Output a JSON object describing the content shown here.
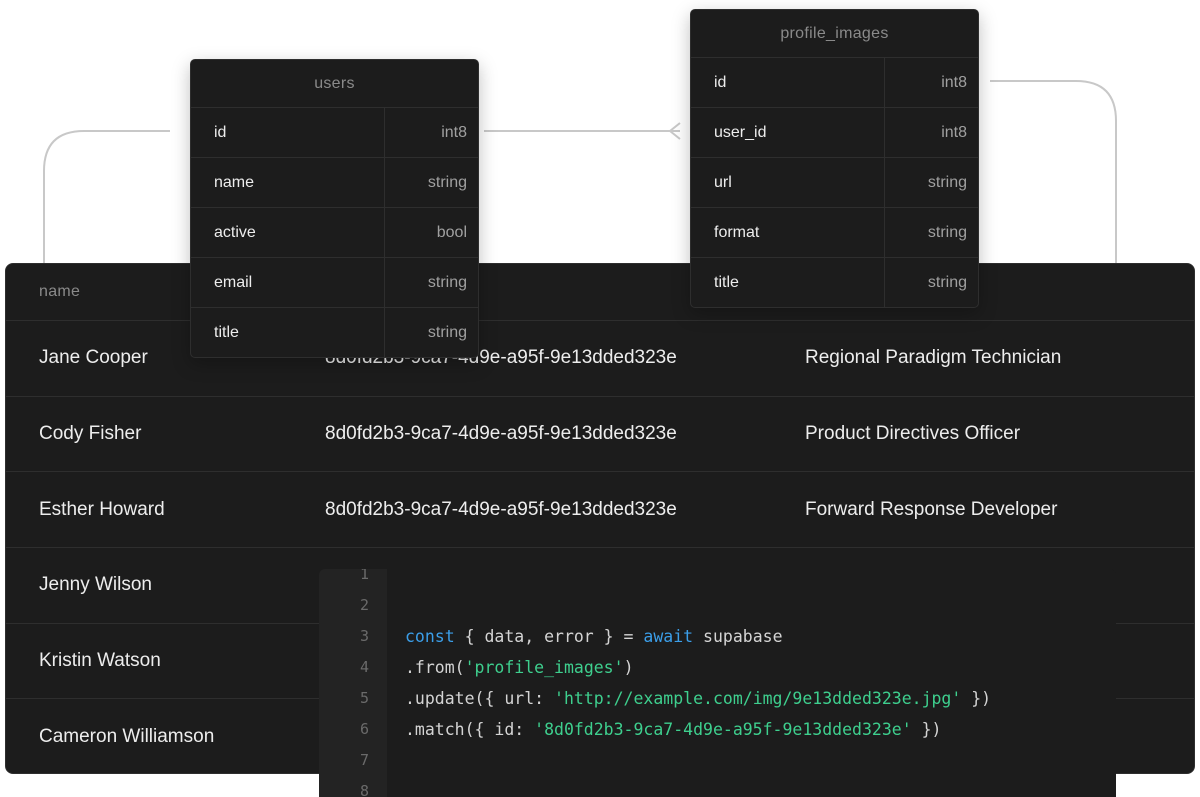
{
  "grid": {
    "header_label": "name",
    "rows": [
      {
        "name": "Jane Cooper",
        "id": "8d0fd2b3-9ca7-4d9e-a95f-9e13dded323e",
        "title": "Regional Paradigm Technician"
      },
      {
        "name": "Cody Fisher",
        "id": "8d0fd2b3-9ca7-4d9e-a95f-9e13dded323e",
        "title": "Product Directives Officer"
      },
      {
        "name": "Esther Howard",
        "id": "8d0fd2b3-9ca7-4d9e-a95f-9e13dded323e",
        "title": "Forward Response Developer"
      },
      {
        "name": "Jenny Wilson",
        "id": "",
        "title": ""
      },
      {
        "name": "Kristin Watson",
        "id": "",
        "title": ""
      },
      {
        "name": "Cameron Williamson",
        "id": "",
        "title": ""
      }
    ]
  },
  "users_table": {
    "title": "users",
    "columns": [
      {
        "field": "id",
        "type": "int8"
      },
      {
        "field": "name",
        "type": "string"
      },
      {
        "field": "active",
        "type": "bool"
      },
      {
        "field": "email",
        "type": "string"
      },
      {
        "field": "title",
        "type": "string"
      }
    ]
  },
  "profile_images_table": {
    "title": "profile_images",
    "columns": [
      {
        "field": "id",
        "type": "int8"
      },
      {
        "field": "user_id",
        "type": "int8"
      },
      {
        "field": "url",
        "type": "string"
      },
      {
        "field": "format",
        "type": "string"
      },
      {
        "field": "title",
        "type": "string"
      }
    ]
  },
  "code": {
    "line_numbers": [
      "1",
      "2",
      "3",
      "4",
      "5",
      "6",
      "7",
      "8"
    ],
    "line3": {
      "kw1": "const",
      "p1": " { data, error } = ",
      "kw2": "await",
      "p2": " supabase"
    },
    "line4": {
      "p1": ".from(",
      "s1": "'profile_images'",
      "p2": ")"
    },
    "line5": {
      "p1": ".update({ url: ",
      "s1": "'http://example.com/img/9e13dded323e.jpg'",
      "p2": " })"
    },
    "line6": {
      "p1": ".match({ id: ",
      "s1": "'8d0fd2b3-9ca7-4d9e-a95f-9e13dded323e'",
      "p2": " })"
    }
  },
  "colors": {
    "panel_bg": "#1c1c1c",
    "border": "#2e2e2e",
    "keyword": "#3b9ee8",
    "string": "#3ecf8e",
    "connector": "#c8c8c8"
  }
}
